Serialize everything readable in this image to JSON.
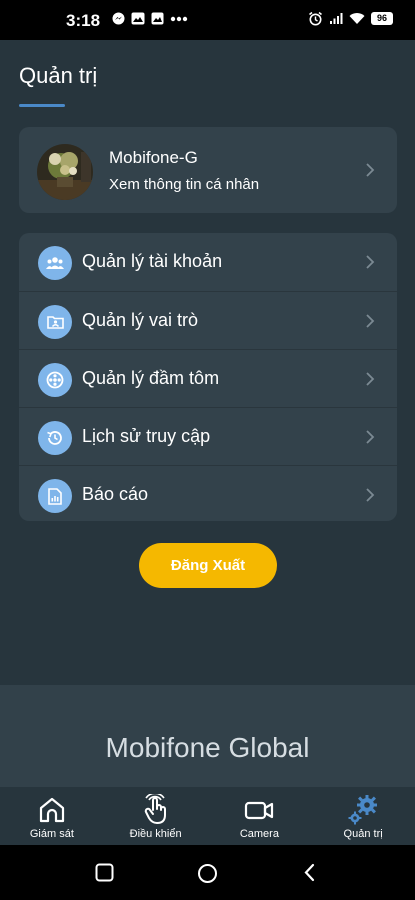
{
  "status_bar": {
    "time": "3:18",
    "battery": "96",
    "notification_icons": [
      "messenger-icon",
      "image-icon",
      "image-icon",
      "more-dots-icon"
    ],
    "status_icons": [
      "alarm-icon",
      "signal-icon",
      "wifi-icon",
      "battery-icon"
    ]
  },
  "header": {
    "title": "Quản trị"
  },
  "profile": {
    "name": "Mobifone-G",
    "subtitle": "Xem thông tin cá nhân"
  },
  "menu": {
    "items": [
      {
        "label": "Quản lý tài khoản",
        "icon": "users-icon"
      },
      {
        "label": "Quản lý vai trò",
        "icon": "id-card-icon"
      },
      {
        "label": "Quản lý đầm tôm",
        "icon": "pond-icon"
      },
      {
        "label": "Lịch sử truy cập",
        "icon": "history-icon"
      },
      {
        "label": "Báo cáo",
        "icon": "report-icon"
      }
    ]
  },
  "logout": {
    "label": "Đăng Xuất"
  },
  "footer": {
    "brand": "Mobifone Global"
  },
  "bottom_nav": {
    "tabs": [
      {
        "label": "Giám sát",
        "icon": "home-icon",
        "active": false
      },
      {
        "label": "Điều khiển",
        "icon": "touch-icon",
        "active": false
      },
      {
        "label": "Camera",
        "icon": "camera-icon",
        "active": false
      },
      {
        "label": "Quản trị",
        "icon": "gears-icon",
        "active": true
      }
    ]
  },
  "colors": {
    "background": "#27353d",
    "card": "#33424b",
    "accent": "#4a89c8",
    "icon_bg": "#7fb5ea",
    "logout": "#f5b800"
  }
}
